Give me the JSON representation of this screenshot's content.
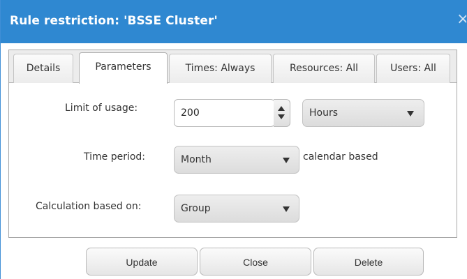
{
  "dialog": {
    "title": "Rule restriction: 'BSSE Cluster'",
    "close_glyph": "×",
    "close_icon": "close-icon"
  },
  "tabs": [
    {
      "label": "Details",
      "active": false
    },
    {
      "label": "Parameters",
      "active": true
    },
    {
      "label": "Times: Always",
      "active": false
    },
    {
      "label": "Resources: All",
      "active": false
    },
    {
      "label": "Users: All",
      "active": false
    }
  ],
  "form": {
    "limit": {
      "label": "Limit of usage:",
      "value": "200",
      "unit_selected": "Hours"
    },
    "time_period": {
      "label": "Time period:",
      "selected": "Month",
      "note": "calendar based"
    },
    "calculation": {
      "label": "Calculation based on:",
      "selected": "Group"
    }
  },
  "buttons": {
    "update": "Update",
    "close": "Close",
    "delete": "Delete"
  },
  "colors": {
    "title_bar": "#2f88d1",
    "title_text": "#ffffff"
  }
}
